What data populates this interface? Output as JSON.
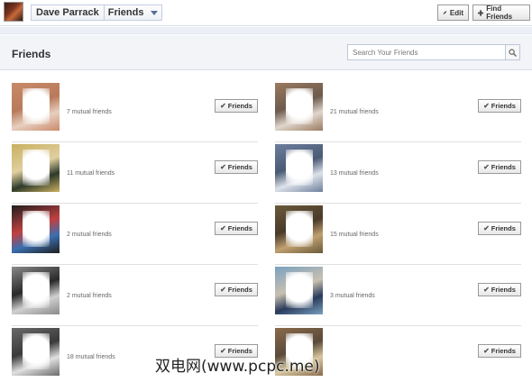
{
  "topbar": {
    "user_name": "Dave Parrack",
    "section": "Friends",
    "edit_label": "Edit",
    "find_label": "Find Friends"
  },
  "header": {
    "title": "Friends",
    "search_placeholder": "Search Your Friends"
  },
  "friend_button_label": "Friends",
  "friends": [
    {
      "mutual": "7 mutual friends",
      "photo": [
        "#c98a6a",
        "#e8cfc0",
        "#b87a5a"
      ]
    },
    {
      "mutual": "21 mutual friends",
      "photo": [
        "#9a7a60",
        "#e0d6cc",
        "#6d5a4c"
      ]
    },
    {
      "mutual": "11 mutual friends",
      "photo": [
        "#c8b060",
        "#2e3a2a",
        "#e0cfa0"
      ]
    },
    {
      "mutual": "13 mutual friends",
      "photo": [
        "#6d7e9c",
        "#dde2ea",
        "#4a5a74"
      ]
    },
    {
      "mutual": "2 mutual friends",
      "photo": [
        "#1e1e1e",
        "#3a6fb0",
        "#c04040"
      ]
    },
    {
      "mutual": "15 mutual friends",
      "photo": [
        "#6a5a3a",
        "#c0a070",
        "#4a3a2a"
      ]
    },
    {
      "mutual": "2 mutual friends",
      "photo": [
        "#8a8a8a",
        "#d0d0d0",
        "#2a2a2a"
      ]
    },
    {
      "mutual": "3 mutual friends",
      "photo": [
        "#7aa0c0",
        "#2a3a5a",
        "#c8c0b0"
      ]
    },
    {
      "mutual": "18 mutual friends",
      "photo": [
        "#6a6a6a",
        "#e0e0e0",
        "#3a3a3a"
      ]
    },
    {
      "mutual": "",
      "photo": [
        "#8a6a4a",
        "#d8c8a0",
        "#5a4a3a"
      ]
    }
  ],
  "watermark": "双电网(www.pcpc.me)",
  "colors": {
    "brand_blue": "#3b5998",
    "header_bg": "#f2f4f8",
    "border": "#d8dfea"
  },
  "icons": {
    "edit": "pencil-icon",
    "find": "plus-icon",
    "search": "magnifier-icon",
    "friend_status": "checkmark-icon",
    "dropdown": "chevron-down-icon"
  }
}
